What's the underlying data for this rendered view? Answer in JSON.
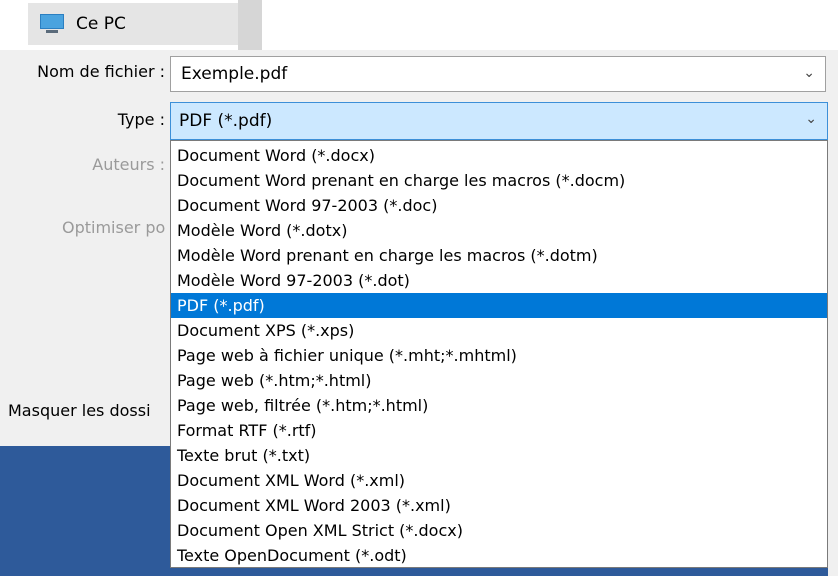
{
  "nav": {
    "location_label": "Ce PC"
  },
  "form": {
    "filename_label": "Nom de fichier :",
    "filename_value": "Exemple.pdf",
    "type_label": "Type :",
    "type_value": "PDF (*.pdf)",
    "authors_label": "Auteurs :",
    "optimize_label": "Optimiser po",
    "hide_folders_label": "Masquer les dossi"
  },
  "dropdown": {
    "selected_index": 6,
    "options": [
      "Document Word (*.docx)",
      "Document Word prenant en charge les macros (*.docm)",
      "Document Word 97-2003 (*.doc)",
      "Modèle Word (*.dotx)",
      "Modèle Word prenant en charge les macros (*.dotm)",
      "Modèle Word 97-2003 (*.dot)",
      "PDF (*.pdf)",
      "Document XPS (*.xps)",
      "Page web à fichier unique (*.mht;*.mhtml)",
      "Page web (*.htm;*.html)",
      "Page web, filtrée (*.htm;*.html)",
      "Format RTF (*.rtf)",
      "Texte brut (*.txt)",
      "Document XML Word (*.xml)",
      "Document XML Word 2003 (*.xml)",
      "Document Open XML Strict (*.docx)",
      "Texte OpenDocument (*.odt)"
    ]
  },
  "colors": {
    "selection": "#0078d7",
    "select_bg": "#cce8ff",
    "dialog_bg": "#f0f0f0",
    "desktop_blue": "#2e5a9a"
  }
}
